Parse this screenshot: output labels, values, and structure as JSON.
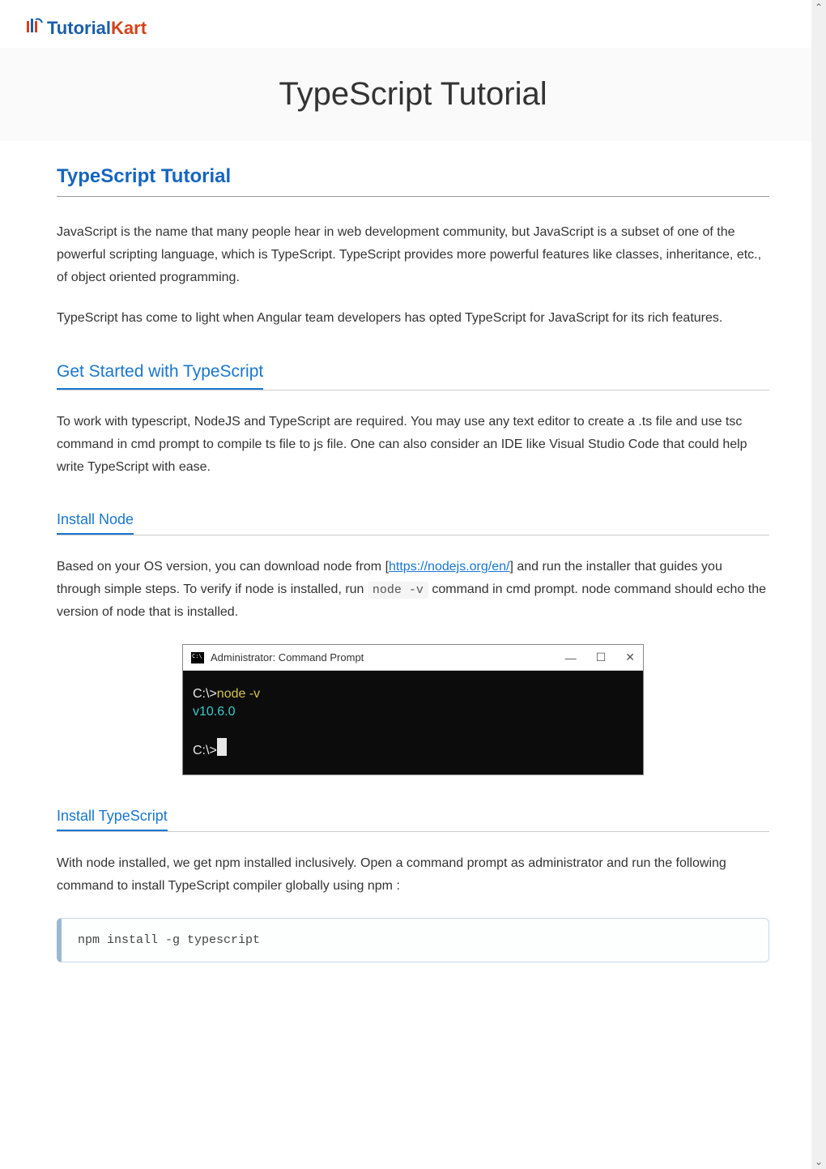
{
  "logo": {
    "part1": "Tutorial",
    "part2": "Kart"
  },
  "page_title": "TypeScript Tutorial",
  "section_heading": "TypeScript Tutorial",
  "intro_para1": "JavaScript is the name that many people hear in web development community, but JavaScript is a subset of one of the powerful scripting language, which is TypeScript. TypeScript provides more powerful features like classes, inheritance, etc., of object oriented programming.",
  "intro_para2": "TypeScript has come to light when Angular team developers has opted TypeScript for JavaScript for its rich features.",
  "get_started": {
    "heading": "Get Started with TypeScript",
    "para": "To work with typescript, NodeJS and TypeScript are required. You may use any text editor to create a .ts file and use tsc command in cmd prompt to compile ts file to js file. One can also consider an IDE like Visual Studio Code that could help write TypeScript with ease."
  },
  "install_node": {
    "heading": "Install Node",
    "para_pre": "Based on your OS version, you can download node from [",
    "link_text": "https://nodejs.org/en/",
    "para_mid": "] and run the installer that guides you through simple steps. To verify if node is installed, run ",
    "code_inline": "node -v",
    "para_post": " command in cmd prompt. node command should echo the version of node that is installed."
  },
  "terminal": {
    "title": "Administrator: Command Prompt",
    "line1_prompt": "C:\\>",
    "line1_cmd": "node -v",
    "line2": "v10.6.0",
    "line3_prompt": "C:\\>",
    "minimize": "—",
    "maximize": "☐",
    "close": "✕",
    "scroll_up": "⌃",
    "scroll_down": "⌄"
  },
  "install_ts": {
    "heading": "Install TypeScript",
    "para": "With node installed, we get npm installed inclusively. Open a command prompt as administrator and run the following command to install TypeScript compiler globally using npm :",
    "code": "npm install -g typescript"
  }
}
